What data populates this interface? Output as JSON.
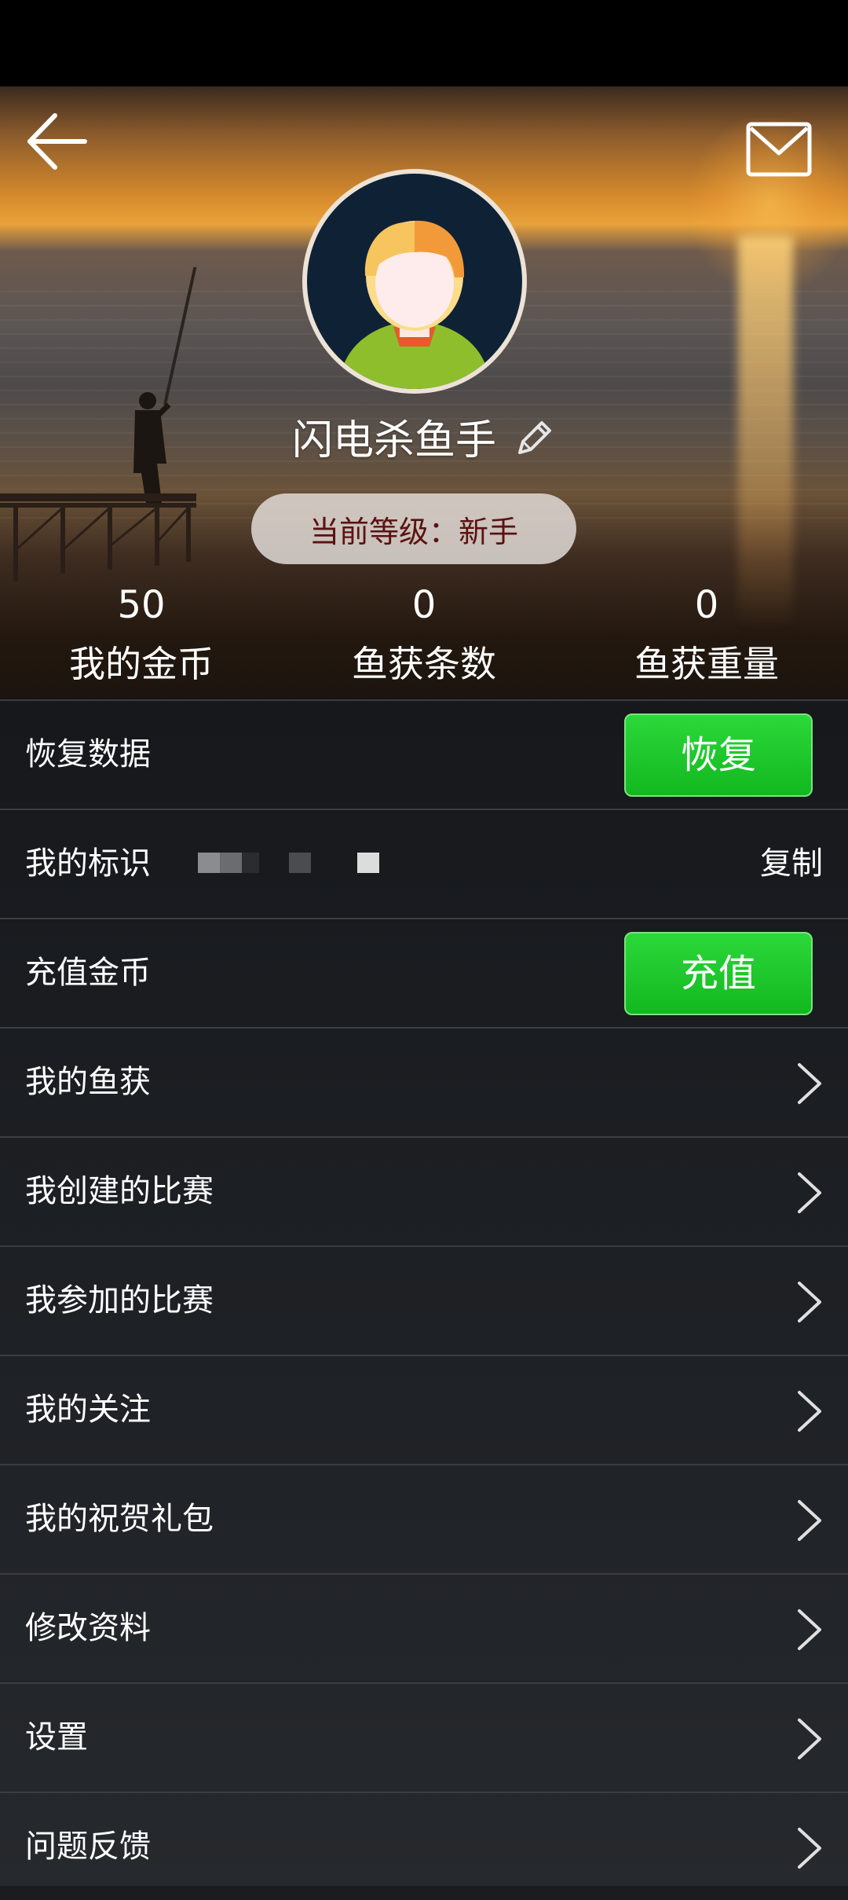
{
  "header": {
    "username": "闪电杀鱼手",
    "level_text": "当前等级：新手"
  },
  "stats": [
    {
      "value": "50",
      "label": "我的金币"
    },
    {
      "value": "0",
      "label": "鱼获条数"
    },
    {
      "value": "0",
      "label": "鱼获重量"
    }
  ],
  "menu": {
    "restore": {
      "label": "恢复数据",
      "button": "恢复"
    },
    "identity": {
      "label": "我的标识",
      "action": "复制"
    },
    "recharge": {
      "label": "充值金币",
      "button": "充值"
    },
    "items": [
      {
        "label": "我的鱼获"
      },
      {
        "label": "我创建的比赛"
      },
      {
        "label": "我参加的比赛"
      },
      {
        "label": "我的关注"
      },
      {
        "label": "我的祝贺礼包"
      },
      {
        "label": "修改资料"
      },
      {
        "label": "设置"
      },
      {
        "label": "问题反馈"
      }
    ]
  },
  "colors": {
    "accent_green": "#1ec92c",
    "level_text": "#5a1212",
    "menu_background": "#1f2226"
  },
  "icons": [
    "back-arrow-icon",
    "mail-icon",
    "edit-pencil-icon",
    "chevron-right-icon"
  ]
}
